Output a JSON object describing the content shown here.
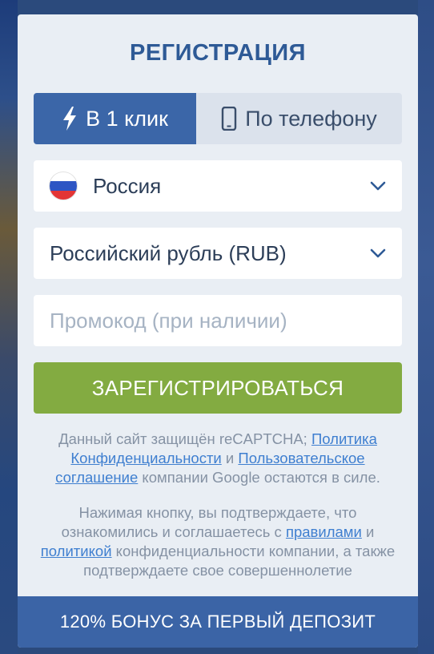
{
  "header": {
    "title": "РЕГИСТРАЦИЯ"
  },
  "tabs": [
    {
      "label": "В 1 клик",
      "icon": "lightning-icon",
      "active": true
    },
    {
      "label": "По телефону",
      "icon": "phone-icon",
      "active": false
    }
  ],
  "form": {
    "country": {
      "value": "Россия",
      "icon": "russia-flag-icon"
    },
    "currency": {
      "value": "Российский рубль (RUB)"
    },
    "promo": {
      "placeholder": "Промокод (при наличии)",
      "value": ""
    },
    "submit_label": "ЗАРЕГИСТРИРОВАТЬСЯ"
  },
  "recaptcha": {
    "text_1": "Данный сайт защищён reCAPTCHA;",
    "link_privacy": "Политика Конфиденциальности",
    "text_and": "и",
    "link_terms": "Пользовательское соглашение",
    "text_2": "компании Google остаются в силе."
  },
  "agreement": {
    "text_1": "Нажимая кнопку, вы подтверждаете, что ознакомились и соглашаетесь с",
    "link_rules": "правилами",
    "text_and": "и",
    "link_policy": "политикой",
    "text_2": "конфиденциальности компании, а также подтверждаете свое совершеннолетие"
  },
  "bonus": {
    "label": "120% БОНУС ЗА ПЕРВЫЙ ДЕПОЗИТ"
  },
  "colors": {
    "brand_blue": "#3b66a8",
    "title_blue": "#2e5a96",
    "register_green": "#83ab41",
    "link_blue": "#3f7fd0",
    "modal_bg": "#e9eef4"
  }
}
